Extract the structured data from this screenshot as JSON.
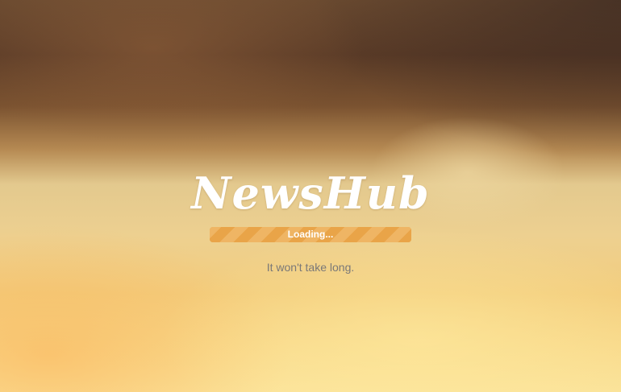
{
  "app": {
    "logo_text": "NewsHub"
  },
  "loader": {
    "progress_label": "Loading...",
    "progress_fraction": 1.0,
    "message": "It won't take long."
  },
  "colors": {
    "progress_stripe_dark": "#e9a448",
    "progress_stripe_light": "#f2c27a",
    "message_text": "#7a7878",
    "logo_text": "#ffffff"
  }
}
